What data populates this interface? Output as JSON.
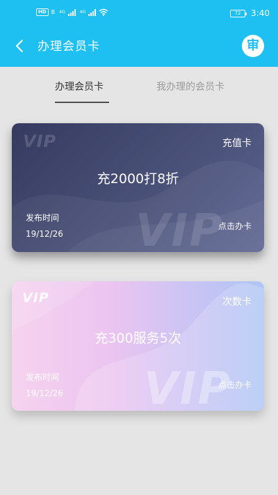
{
  "status_bar": {
    "network_badge": "HD",
    "network_badge_sub": "B",
    "signal_1_label": "4G",
    "signal_2_label": "4G",
    "battery": "72",
    "time": "3:40"
  },
  "header": {
    "title": "办理会员卡",
    "action_badge": "审"
  },
  "tabs": [
    {
      "label": "办理会员卡",
      "active": true
    },
    {
      "label": "我办理的会员卡",
      "active": false
    }
  ],
  "cards": [
    {
      "watermark": "VIP",
      "type": "充值卡",
      "title": "充2000打8折",
      "publish_label": "发布时间",
      "publish_date": "19/12/26",
      "action": "点击办卡"
    },
    {
      "watermark": "VIP",
      "type": "次数卡",
      "title": "充300服务5次",
      "publish_label": "发布时间",
      "publish_date": "19/12/26",
      "action": "点击办卡"
    }
  ],
  "colors": {
    "accent": "#1ec0f2",
    "background": "#e5e5e5",
    "card1_start": "#353b60",
    "card1_end": "#5b6390",
    "card2_start": "#f6d3ef",
    "card2_end": "#aec5f5"
  }
}
